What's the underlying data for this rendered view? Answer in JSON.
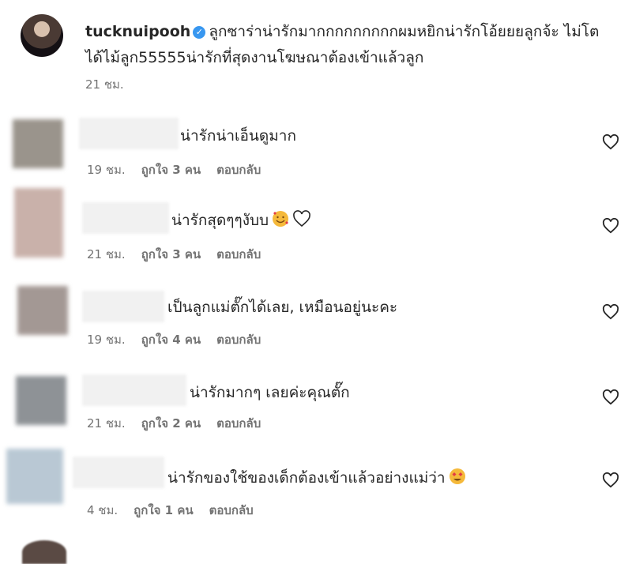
{
  "post": {
    "username": "tucknuipooh",
    "caption": "ลูกซาร่าน่ารักมากกกกกกกกกผมหยิกน่ารักโอ้ยยยลูกจ้ะ ไม่โตได้ไม้ลูก55555น่ารักที่สุดงานโฆษณาต้องเข้าแล้วลูก",
    "time": "21 ชม."
  },
  "comments": [
    {
      "text": "น่ารักน่าเอ็นดูมาก",
      "time": "19 ชม.",
      "likes": "ถูกใจ 3 คน",
      "reply": "ตอบกลับ"
    },
    {
      "text": "น่ารักสุดๆๆงับบ",
      "time": "21 ชม.",
      "likes": "ถูกใจ 3 คน",
      "reply": "ตอบกลับ"
    },
    {
      "text": "เป็นลูกแม่ตั๊กได้เลย, เหมือนอยู่นะคะ",
      "time": "19 ชม.",
      "likes": "ถูกใจ 4 คน",
      "reply": "ตอบกลับ"
    },
    {
      "text": "น่ารักมากๆ เลยค่ะคุณตั๊ก",
      "time": "21 ชม.",
      "likes": "ถูกใจ 2 คน",
      "reply": "ตอบกลับ"
    },
    {
      "text": "น่ารักของใช้ของเด็กต้องเข้าแล้วอย่างแม่ว่า",
      "time": "4 ชม.",
      "likes": "ถูกใจ 1 คน",
      "reply": "ตอบกลับ"
    }
  ]
}
